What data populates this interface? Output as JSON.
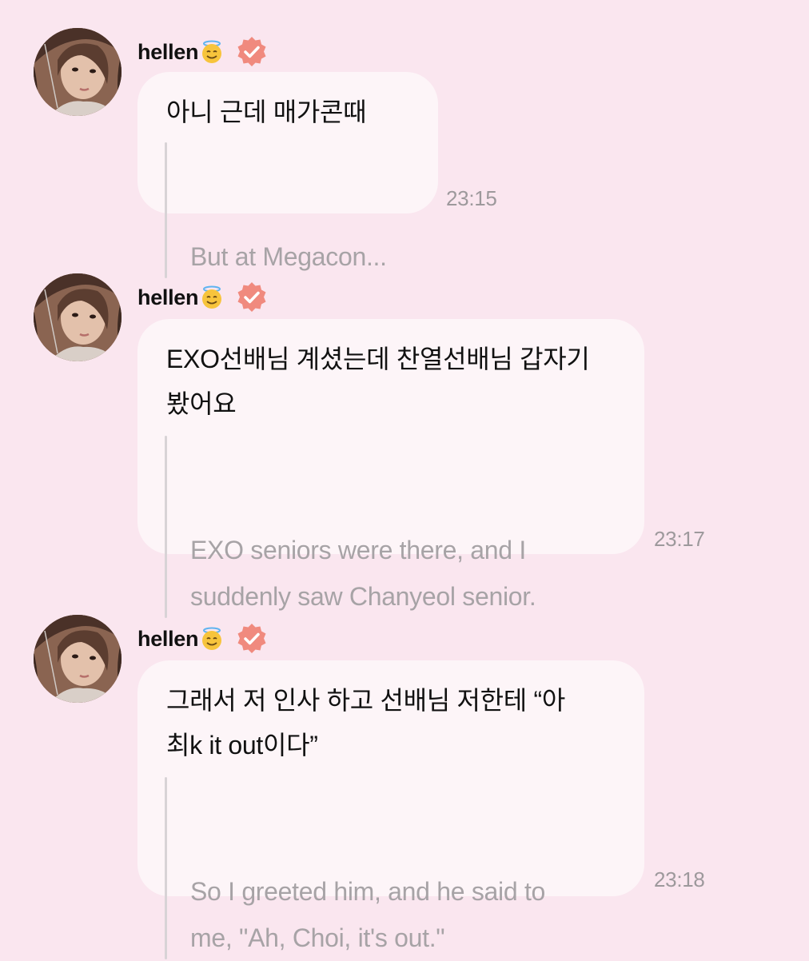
{
  "messages": [
    {
      "username": "hellen",
      "text": "아니 근데 매가콘때",
      "translation": "But at Megacon...",
      "time": "23:15"
    },
    {
      "username": "hellen",
      "text": "EXO선배님 계셨는데 찬열선배님 갑자기\n봤어요",
      "translation": "EXO seniors were there, and I\nsuddenly saw Chanyeol senior.",
      "time": "23:17"
    },
    {
      "username": "hellen",
      "text": "그래서 저 인사 하고 선배님 저한테 “아\n최k it out이다”",
      "translation": "So I greeted him, and he said to\nme, \"Ah, Choi, it's out.\"",
      "time": "23:18"
    }
  ],
  "icons": {
    "emoji": "smiling-face-with-halo-icon",
    "badge": "verified-badge-icon"
  },
  "colors": {
    "background": "#fae6ef",
    "bubble": "#fdf5f8",
    "badge": "#f08a7e",
    "translation_text": "#a7a3a6"
  }
}
